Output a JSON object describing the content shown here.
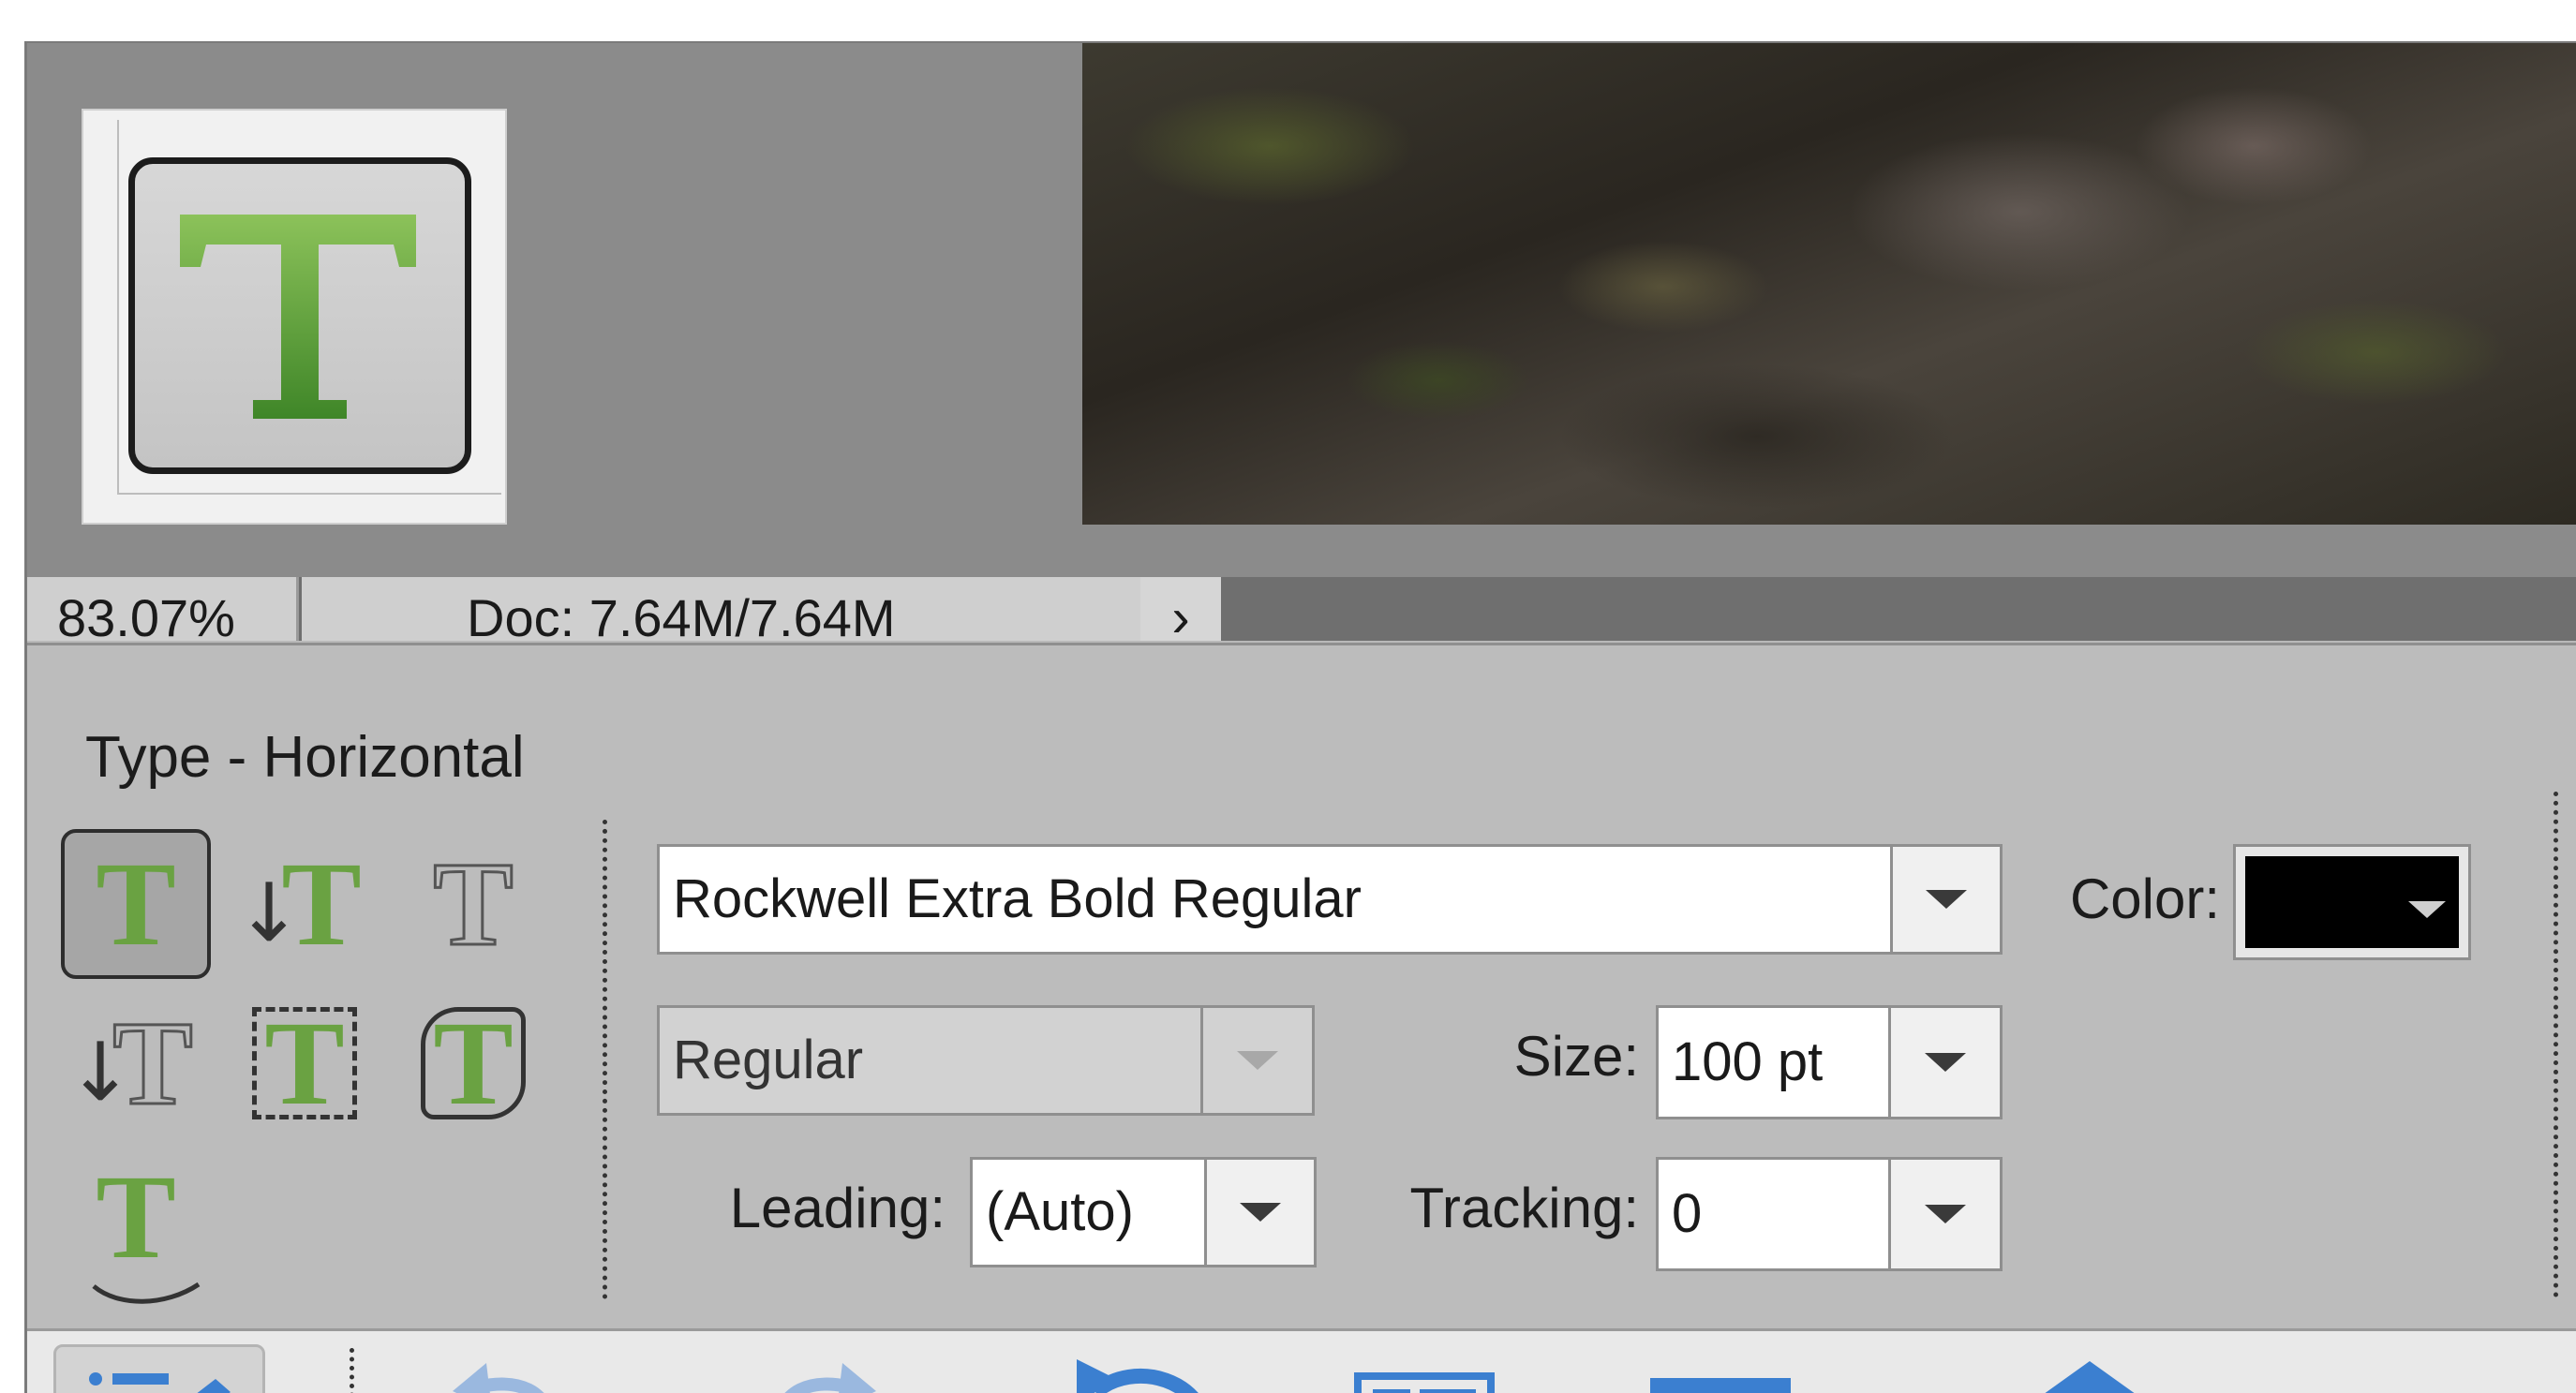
{
  "status_bar": {
    "zoom": "83.07%",
    "doc_info": "Doc: 7.64M/7.64M",
    "expand_arrow": "›"
  },
  "tool_options": {
    "title": "Type - Horizontal",
    "tool_glyph": "T",
    "font_family": "Rockwell Extra Bold Regular",
    "font_style": "Regular",
    "size_label": "Size:",
    "size_value": "100 pt",
    "leading_label": "Leading:",
    "leading_value": "(Auto)",
    "tracking_label": "Tracking:",
    "tracking_value": "0",
    "color_label": "Color:",
    "color_value": "#000000",
    "type_tools": [
      {
        "name": "horizontal-type-tool",
        "selected": true
      },
      {
        "name": "vertical-type-tool",
        "selected": false
      },
      {
        "name": "horizontal-type-mask-tool",
        "selected": false
      },
      {
        "name": "vertical-type-mask-tool",
        "selected": false
      },
      {
        "name": "text-on-selection-tool",
        "selected": false
      },
      {
        "name": "text-on-shape-tool",
        "selected": false
      },
      {
        "name": "text-on-path-tool",
        "selected": false
      }
    ]
  },
  "theme": {
    "accent_green": "#6aa242",
    "toolbar_blue": "#3b7fd0"
  }
}
